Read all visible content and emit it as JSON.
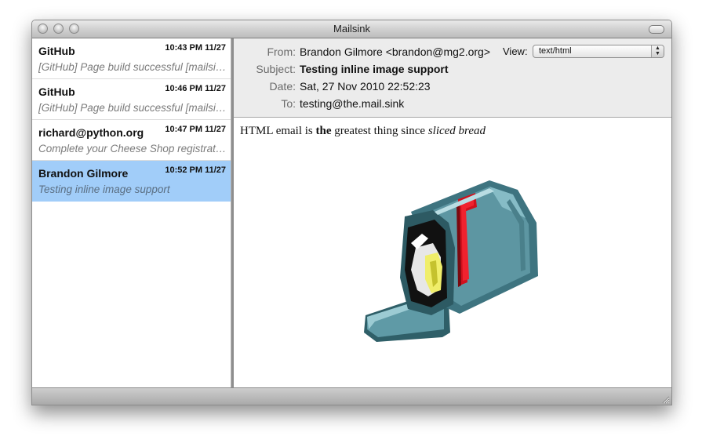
{
  "window": {
    "title": "Mailsink"
  },
  "messages": [
    {
      "from": "GitHub",
      "time": "10:43 PM 11/27",
      "subject": "[GitHub] Page build successful [mailsink]",
      "selected": false
    },
    {
      "from": "GitHub",
      "time": "10:46 PM 11/27",
      "subject": "[GitHub] Page build successful [mailsink]",
      "selected": false
    },
    {
      "from": "richard@python.org",
      "time": "10:47 PM 11/27",
      "subject": "Complete your Cheese Shop registration",
      "selected": false
    },
    {
      "from": "Brandon Gilmore",
      "time": "10:52 PM 11/27",
      "subject": "Testing inline image support",
      "selected": true
    }
  ],
  "header": {
    "from_label": "From:",
    "from_value": "Brandon Gilmore <brandon@mg2.org>",
    "subject_label": "Subject:",
    "subject_value": "Testing inline image support",
    "date_label": "Date:",
    "date_value": "Sat, 27 Nov 2010 22:52:23",
    "to_label": "To:",
    "to_value": "testing@the.mail.sink",
    "view_label": "View:",
    "view_value": "text/html"
  },
  "body": {
    "text_1": "HTML email is ",
    "text_bold": "the",
    "text_2": " greatest thing since ",
    "text_italic": "sliced bread",
    "image": "mailbox-icon"
  },
  "colors": {
    "selection": "#a1cdf9",
    "mailbox_body": "#4f8a96",
    "flag": "#d0101c"
  }
}
